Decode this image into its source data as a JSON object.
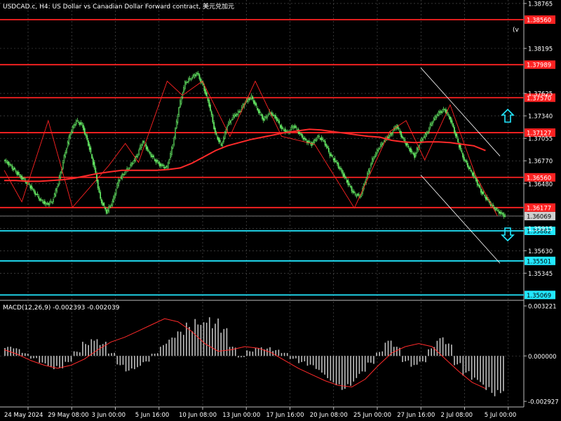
{
  "title": "USDCAD.c, H4:  US Dollar vs Canadian Dollar Forward contract, 美元兑加元",
  "indicator_title": "MACD(12,26,9) -0.002393 -0.002039",
  "corner_mark": "(v",
  "colors": {
    "background": "#000000",
    "bull_candle": "#66ee66",
    "bear_candle": "#66ee66",
    "resistance": "#ff2222",
    "support": "#22e8ff",
    "ma": "#ff2a2a",
    "zigzag": "#ff2222",
    "channel": "#ffffff",
    "macd_hist": "#c0c0c0",
    "macd_signal": "#ff2a2a",
    "grid": "#5a5a5a",
    "arrow": "#22e8ff"
  },
  "chart_data": [
    {
      "type": "candlestick",
      "symbol": "USDCAD.c",
      "timeframe": "H4",
      "ylim": [
        1.35001,
        1.38809
      ],
      "y_ticks": [
        "1.38765",
        "1.38560",
        "1.38195",
        "1.37989",
        "1.37625",
        "1.37340",
        "1.37055",
        "1.36770",
        "1.36480",
        "1.36177",
        "1.36069",
        "1.35915",
        "1.35882",
        "1.35630",
        "1.35501",
        "1.35345",
        "1.35069"
      ],
      "x_ticks": [
        "24 May 2024",
        "29 May 08:00",
        "3 Jun 00:00",
        "5 Jun 16:00",
        "10 Jun 08:00",
        "13 Jun 00:00",
        "17 Jun 16:00",
        "20 Jun 08:00",
        "25 Jun 00:00",
        "27 Jun 16:00",
        "2 Jul 08:00",
        "5 Jul 00:00"
      ],
      "horizontal_levels": [
        {
          "label": "1.38560",
          "value": 1.3856,
          "kind": "resistance"
        },
        {
          "label": "1.37989",
          "value": 1.37989,
          "kind": "resistance"
        },
        {
          "label": "1.37570",
          "value": 1.3757,
          "kind": "resistance"
        },
        {
          "label": "1.37127",
          "value": 1.37127,
          "kind": "resistance"
        },
        {
          "label": "1.36560",
          "value": 1.3656,
          "kind": "resistance"
        },
        {
          "label": "1.36177",
          "value": 1.36177,
          "kind": "resistance"
        },
        {
          "label": "1.35882",
          "value": 1.35882,
          "kind": "support"
        },
        {
          "label": "1.35501",
          "value": 1.35501,
          "kind": "support"
        },
        {
          "label": "1.35069",
          "value": 1.35069,
          "kind": "support"
        }
      ],
      "current_price": "1.36069",
      "close_series": [
        1.3672,
        1.3663,
        1.3655,
        1.3648,
        1.3638,
        1.3628,
        1.3622,
        1.3625,
        1.3648,
        1.3682,
        1.3712,
        1.3728,
        1.3722,
        1.3698,
        1.3668,
        1.3628,
        1.3612,
        1.3625,
        1.3652,
        1.3662,
        1.3671,
        1.3683,
        1.3702,
        1.3688,
        1.3678,
        1.3671,
        1.3668,
        1.3698,
        1.3745,
        1.3776,
        1.3782,
        1.3788,
        1.3772,
        1.3748,
        1.3712,
        1.3696,
        1.3722,
        1.3733,
        1.3739,
        1.3752,
        1.3758,
        1.3742,
        1.3729,
        1.3738,
        1.3732,
        1.3718,
        1.3713,
        1.3722,
        1.3711,
        1.3702,
        1.3698,
        1.3708,
        1.3702,
        1.3685,
        1.3675,
        1.3662,
        1.3648,
        1.3635,
        1.3632,
        1.3655,
        1.3678,
        1.3692,
        1.3703,
        1.371,
        1.3722,
        1.3706,
        1.3693,
        1.3683,
        1.3702,
        1.3712,
        1.3728,
        1.3738,
        1.3742,
        1.3728,
        1.3705,
        1.3682,
        1.3668,
        1.3655,
        1.3638,
        1.3628,
        1.3618,
        1.3612,
        1.3607
      ],
      "moving_average": [
        1.3652,
        1.3652,
        1.3651,
        1.3651,
        1.3652,
        1.3653,
        1.3655,
        1.3658,
        1.3661,
        1.3663,
        1.3665,
        1.3665,
        1.3665,
        1.3665,
        1.3666,
        1.3668,
        1.3674,
        1.3682,
        1.369,
        1.3696,
        1.37,
        1.3704,
        1.3707,
        1.371,
        1.3713,
        1.3715,
        1.3717,
        1.3716,
        1.3714,
        1.3712,
        1.371,
        1.3708,
        1.3707,
        1.3703,
        1.3701,
        1.37,
        1.3701,
        1.3701,
        1.37,
        1.3698,
        1.3696,
        1.369
      ],
      "zigzag": [
        [
          0,
          1.3665
        ],
        [
          16,
          1.3625
        ],
        [
          40,
          1.3728
        ],
        [
          62,
          1.3618
        ],
        [
          95,
          1.3671
        ],
        [
          110,
          1.3699
        ],
        [
          122,
          1.3675
        ],
        [
          148,
          1.3778
        ],
        [
          162,
          1.376
        ],
        [
          180,
          1.3778
        ],
        [
          205,
          1.3708
        ],
        [
          228,
          1.3778
        ],
        [
          252,
          1.3708
        ],
        [
          282,
          1.3698
        ],
        [
          318,
          1.3617
        ],
        [
          350,
          1.3714
        ],
        [
          365,
          1.3728
        ],
        [
          382,
          1.3678
        ],
        [
          405,
          1.3748
        ],
        [
          428,
          1.3659
        ],
        [
          448,
          1.3607
        ]
      ],
      "channel_lines": [
        [
          [
            600,
            1.3795
          ],
          [
            713,
            1.3683
          ]
        ],
        [
          [
            600,
            1.3659
          ],
          [
            713,
            1.3547
          ]
        ]
      ]
    },
    {
      "type": "histogram",
      "name": "MACD(12,26,9)",
      "ylim": [
        -0.002927,
        0.003221
      ],
      "y_ticks": [
        "0.003221",
        "0.000000",
        "-0.002927"
      ],
      "macd_hist": [
        0.0006,
        0.0005,
        0.0002,
        -0.0002,
        -0.0006,
        -0.0009,
        -0.0008,
        -0.0004,
        0.0003,
        0.001,
        0.0014,
        0.001,
        0.0002,
        -0.0006,
        -0.001,
        -0.0009,
        -0.0005,
        0.0002,
        0.0008,
        0.0012,
        0.0016,
        0.0022,
        0.0028,
        0.003,
        0.0025,
        0.0018,
        0.0006,
        -0.0001,
        0.0004,
        0.0007,
        0.0006,
        0.0004,
        0.0002,
        -0.0002,
        -0.0005,
        -0.0008,
        -0.0012,
        -0.0016,
        -0.0019,
        -0.0022,
        -0.002,
        -0.0014,
        -0.0006,
        0.0003,
        0.001,
        0.0006,
        -0.0004,
        -0.0008,
        -0.0005,
        0.0006,
        0.0012,
        0.0008,
        -0.0006,
        -0.0014,
        -0.002,
        -0.0024,
        -0.0026,
        -0.0024
      ],
      "macd_signal": [
        0.0004,
        0.0001,
        -0.0003,
        -0.0006,
        -0.0008,
        -0.0006,
        -0.0002,
        0.0004,
        0.0009,
        0.0012,
        0.0016,
        0.002,
        0.0024,
        0.0022,
        0.0016,
        0.0008,
        0.0003,
        0.0004,
        0.0006,
        0.0005,
        0.0002,
        -0.0003,
        -0.0008,
        -0.0012,
        -0.0016,
        -0.0019,
        -0.002,
        -0.0015,
        -0.0006,
        0.0002,
        0.0006,
        0.0008,
        0.0006,
        -0.0002,
        -0.001,
        -0.0017,
        -0.0021
      ]
    }
  ]
}
